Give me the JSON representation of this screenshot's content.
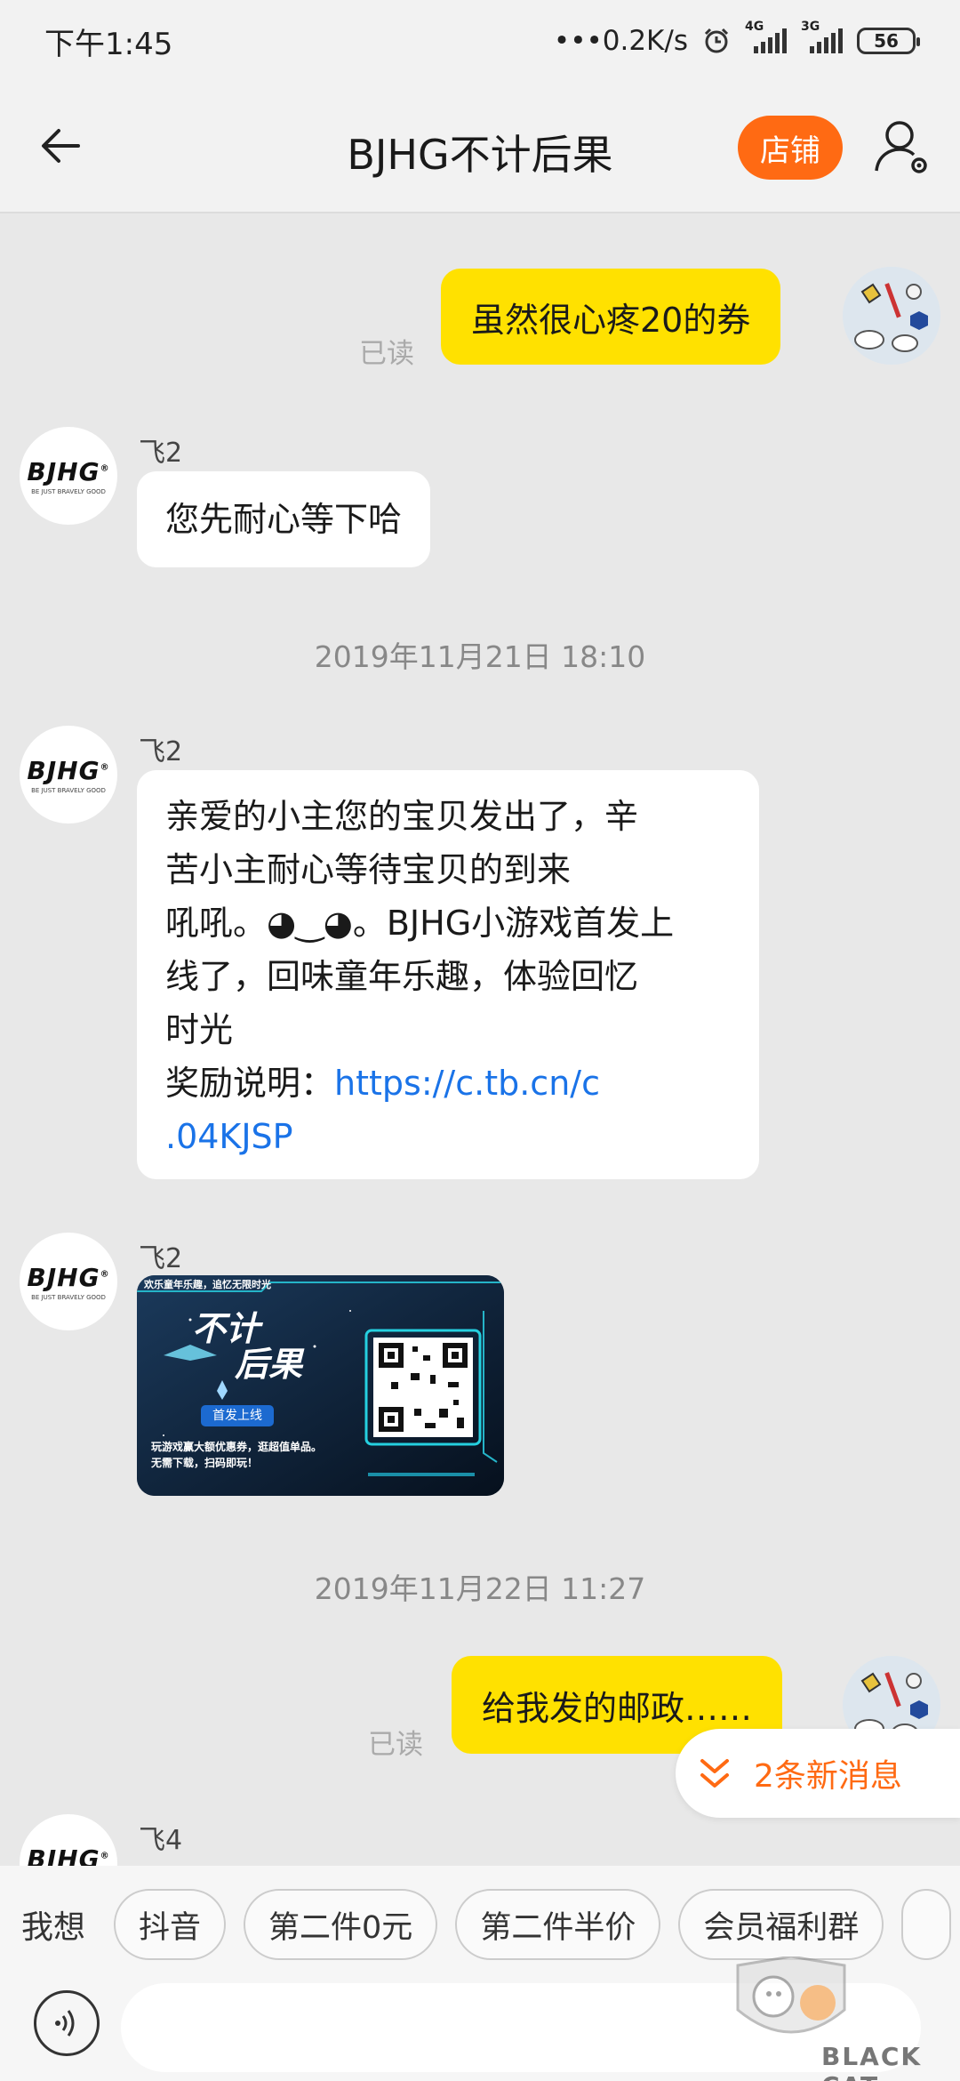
{
  "status_bar": {
    "time": "下午1:45",
    "speed": "•••0.2K/s",
    "net1": "4G",
    "net2": "3G",
    "battery": "56"
  },
  "header": {
    "title": "BJHG不计后果",
    "shop_label": "店铺"
  },
  "messages": {
    "m1": {
      "text": "虽然很心疼20的券",
      "read": "已读"
    },
    "m2": {
      "sender": "飞2",
      "text": "您先耐心等下哈"
    },
    "ts1": "2019年11月21日 18:10",
    "m3": {
      "sender": "飞2",
      "line1": "亲爱的小主您的宝贝发出了，辛",
      "line2": "苦小主耐心等待宝贝的到来",
      "line3": "吼吼。◕‿◕。BJHG小游戏首发上",
      "line4": "线了，回味童年乐趣，体验回忆",
      "line5": "时光",
      "line6_prefix": "奖励说明：",
      "link1": "https://c.tb.cn/c",
      "link2": ".04KJSP"
    },
    "m4": {
      "sender": "飞2",
      "card_banner": "欢乐童年乐趣，追忆无限时光",
      "card_title1": "不计",
      "card_title2": "后果",
      "card_badge": "首发上线",
      "card_desc1": "玩游戏赢大额优惠券，逛超值单品。",
      "card_desc2": "无需下载，扫码即玩！"
    },
    "ts2": "2019年11月22日 11:27",
    "m5": {
      "text": "给我发的邮政……",
      "read": "已读"
    },
    "m6": {
      "sender": "飞4"
    }
  },
  "avatar_logo": {
    "text": "BJHG",
    "mark": "®",
    "sub": "BE JUST BRAVELY GOOD"
  },
  "new_messages": "2条新消息",
  "quick_bar": {
    "label": "我想",
    "chips": [
      "抖音",
      "第二件0元",
      "第二件半价",
      "会员福利群"
    ]
  },
  "watermark": {
    "text": "BLACK CAT"
  },
  "colors": {
    "accent": "#ff6a13",
    "my_bubble": "#ffe100",
    "link": "#1a73e8",
    "background": "#e8e8e8"
  }
}
